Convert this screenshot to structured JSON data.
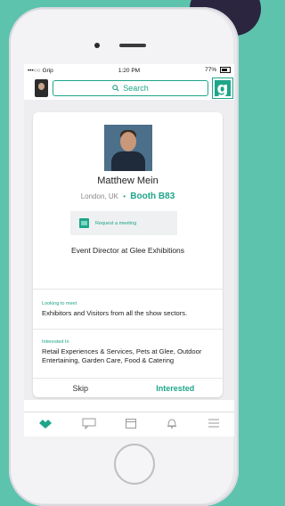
{
  "status_bar": {
    "carrier": "•••○○ Grip",
    "time": "1:20 PM",
    "battery": "77%"
  },
  "search": {
    "label": "Search"
  },
  "logo": {
    "letter": "g"
  },
  "profile": {
    "name": "Matthew Mein",
    "location": "London, UK",
    "separator": "•",
    "booth": "Booth B83",
    "meeting_button": "Request a meeting",
    "job_title": "Event Director at Glee Exhibitions"
  },
  "looking_to_meet": {
    "label": "Looking to meet",
    "text": "Exhibitors and Visitors from all the show sectors."
  },
  "interested_in": {
    "label": "Interested In",
    "text": "Retail Experiences & Services, Pets at Glee, Outdoor Entertaining, Garden Care, Food & Catering"
  },
  "actions": {
    "skip": "Skip",
    "interested": "Interested"
  },
  "tabs": [
    {
      "icon": "handshake-icon"
    },
    {
      "icon": "chat-icon"
    },
    {
      "icon": "calendar-icon"
    },
    {
      "icon": "bell-icon"
    },
    {
      "icon": "menu-icon"
    }
  ],
  "colors": {
    "accent": "#1ea58a",
    "background": "#5dc3ad"
  }
}
